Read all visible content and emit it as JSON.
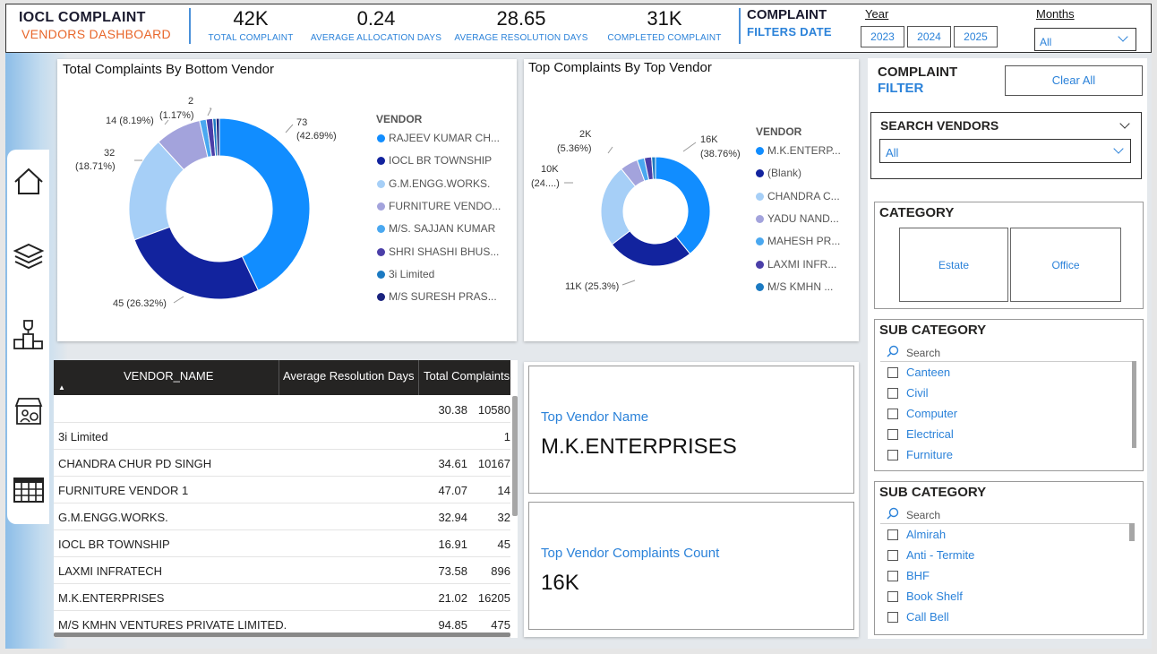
{
  "header": {
    "title": "IOCL COMPLAINT",
    "subtitle": "VENDORS DASHBOARD",
    "kpis": [
      {
        "value": "42K",
        "label": "TOTAL COMPLAINT"
      },
      {
        "value": "0.24",
        "label": "AVERAGE ALLOCATION DAYS"
      },
      {
        "value": "28.65",
        "label": "AVERAGE RESOLUTION DAYS"
      },
      {
        "value": "31K",
        "label": "COMPLETED COMPLAINT"
      }
    ],
    "filter_title": "COMPLAINT",
    "filter_sub": "FILTERS DATE",
    "year_label": "Year",
    "years": [
      "2023",
      "2024",
      "2025"
    ],
    "months_label": "Months",
    "months_value": "All"
  },
  "sidebar": {
    "icons": [
      "home-icon",
      "layers-icon",
      "trophy-icon",
      "store-icon",
      "table-icon"
    ]
  },
  "chart_left": {
    "title": "Total Complaints By Bottom Vendor",
    "legend_title": "VENDOR",
    "legend": [
      "RAJEEV KUMAR CH...",
      "IOCL BR TOWNSHIP",
      "G.M.ENGG.WORKS.",
      "FURNITURE VENDO...",
      "M/S. SAJJAN KUMAR",
      "SHRI SHASHI BHUS...",
      "3i Limited",
      "M/S SURESH PRAS..."
    ],
    "labels": {
      "l73a": "73",
      "l73b": "(42.69%)",
      "l45": "45 (26.32%)",
      "l32a": "32",
      "l32b": "(18.71%)",
      "l14": "14 (8.19%)",
      "l2a": "2",
      "l2b": "(1.17%)"
    }
  },
  "chart_right": {
    "title": "Top Complaints By Top Vendor",
    "legend_title": "VENDOR",
    "legend": [
      "M.K.ENTERP...",
      "(Blank)",
      "CHANDRA C...",
      "YADU NAND...",
      "MAHESH PR...",
      "LAXMI INFR...",
      "M/S KMHN ..."
    ],
    "labels": {
      "l16a": "16K",
      "l16b": "(38.76%)",
      "l11": "11K (25.3%)",
      "l10a": "10K",
      "l10b": "(24....)",
      "l2a": "2K",
      "l2b": "(5.36%)"
    }
  },
  "colors": {
    "c1": "#118dff",
    "c2": "#12239e",
    "c3": "#a6cff7",
    "c4": "#a3a3dc",
    "c5": "#4aa8f0",
    "c6": "#4b3fa8",
    "c7": "#1b7ac2",
    "c8": "#1a237e"
  },
  "chart_data": [
    {
      "type": "pie",
      "title": "Total Complaints By Bottom Vendor",
      "categories": [
        "RAJEEV KUMAR CH...",
        "IOCL BR TOWNSHIP",
        "G.M.ENGG.WORKS.",
        "FURNITURE VENDO...",
        "M/S. SAJJAN KUMAR",
        "SHRI SHASHI BHUS...",
        "3i Limited",
        "M/S SURESH PRAS..."
      ],
      "values": [
        73,
        45,
        32,
        14,
        2,
        2,
        1,
        1
      ],
      "legend_title": "VENDOR",
      "legend_position": "right"
    },
    {
      "type": "pie",
      "title": "Top Complaints By Top Vendor",
      "categories": [
        "M.K.ENTERP...",
        "(Blank)",
        "CHANDRA C...",
        "YADU NAND...",
        "MAHESH PR...",
        "LAXMI INFR...",
        "M/S KMHN ..."
      ],
      "values": [
        16205,
        10580,
        10167,
        2200,
        896,
        896,
        475
      ],
      "legend_title": "VENDOR",
      "legend_position": "right"
    }
  ],
  "table": {
    "headers": [
      "VENDOR_NAME",
      "Average Resolution Days",
      "Total Complaints"
    ],
    "rows": [
      [
        "",
        "30.38",
        "10580"
      ],
      [
        "3i Limited",
        "",
        "1"
      ],
      [
        "CHANDRA CHUR PD SINGH",
        "34.61",
        "10167"
      ],
      [
        "FURNITURE VENDOR 1",
        "47.07",
        "14"
      ],
      [
        "G.M.ENGG.WORKS.",
        "32.94",
        "32"
      ],
      [
        "IOCL BR TOWNSHIP",
        "16.91",
        "45"
      ],
      [
        "LAXMI INFRATECH",
        "73.58",
        "896"
      ],
      [
        "M.K.ENTERPRISES",
        "21.02",
        "16205"
      ],
      [
        "M/S KMHN VENTURES PRIVATE LIMITED.",
        "94.85",
        "475"
      ]
    ]
  },
  "cards": {
    "top_vendor_label": "Top Vendor Name",
    "top_vendor_value": "M.K.ENTERPRISES",
    "top_count_label": "Top Vendor Complaints Count",
    "top_count_value": "16K"
  },
  "filters": {
    "title": "COMPLAINT",
    "subtitle": "FILTER",
    "clear_all": "Clear All",
    "search_vendors_label": "SEARCH VENDORS",
    "search_vendors_value": "All",
    "category_label": "CATEGORY",
    "categories": [
      "Estate",
      "Office"
    ],
    "subcat1_label": "SUB CATEGORY",
    "subcat1_search": "Search",
    "subcat1_items": [
      "Canteen",
      "Civil",
      "Computer",
      "Electrical",
      "Furniture"
    ],
    "subcat2_label": "SUB CATEGORY",
    "subcat2_search": "Search",
    "subcat2_items": [
      "Almirah",
      "Anti - Termite",
      "BHF",
      "Book Shelf",
      "Call Bell"
    ]
  }
}
